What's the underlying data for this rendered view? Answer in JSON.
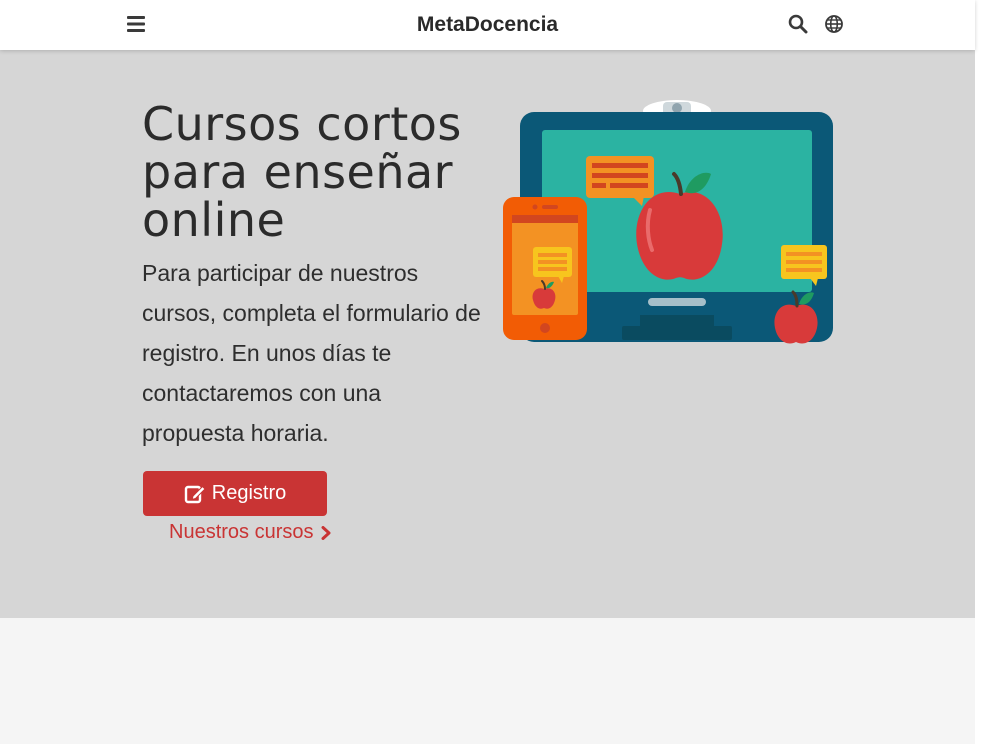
{
  "navbar": {
    "brand": "MetaDocencia",
    "icons": {
      "menu": "hamburger-menu-icon",
      "search": "search-icon",
      "language": "globe-icon"
    }
  },
  "hero": {
    "title": "Cursos cortos para enseñar online",
    "lead": "Para participar de nuestros cursos, completa el formulario de registro. En unos días te contactaremos con una propuesta horaria.",
    "register_button": "Registro",
    "register_icon": "edit-icon",
    "courses_link": "Nuestros cursos",
    "courses_link_icon": "chevron-right-icon"
  },
  "colors": {
    "accent": "#c93434",
    "hero_background": "#d6d6d6",
    "page_background": "#f5f5f5",
    "navbar_background": "#ffffff"
  }
}
